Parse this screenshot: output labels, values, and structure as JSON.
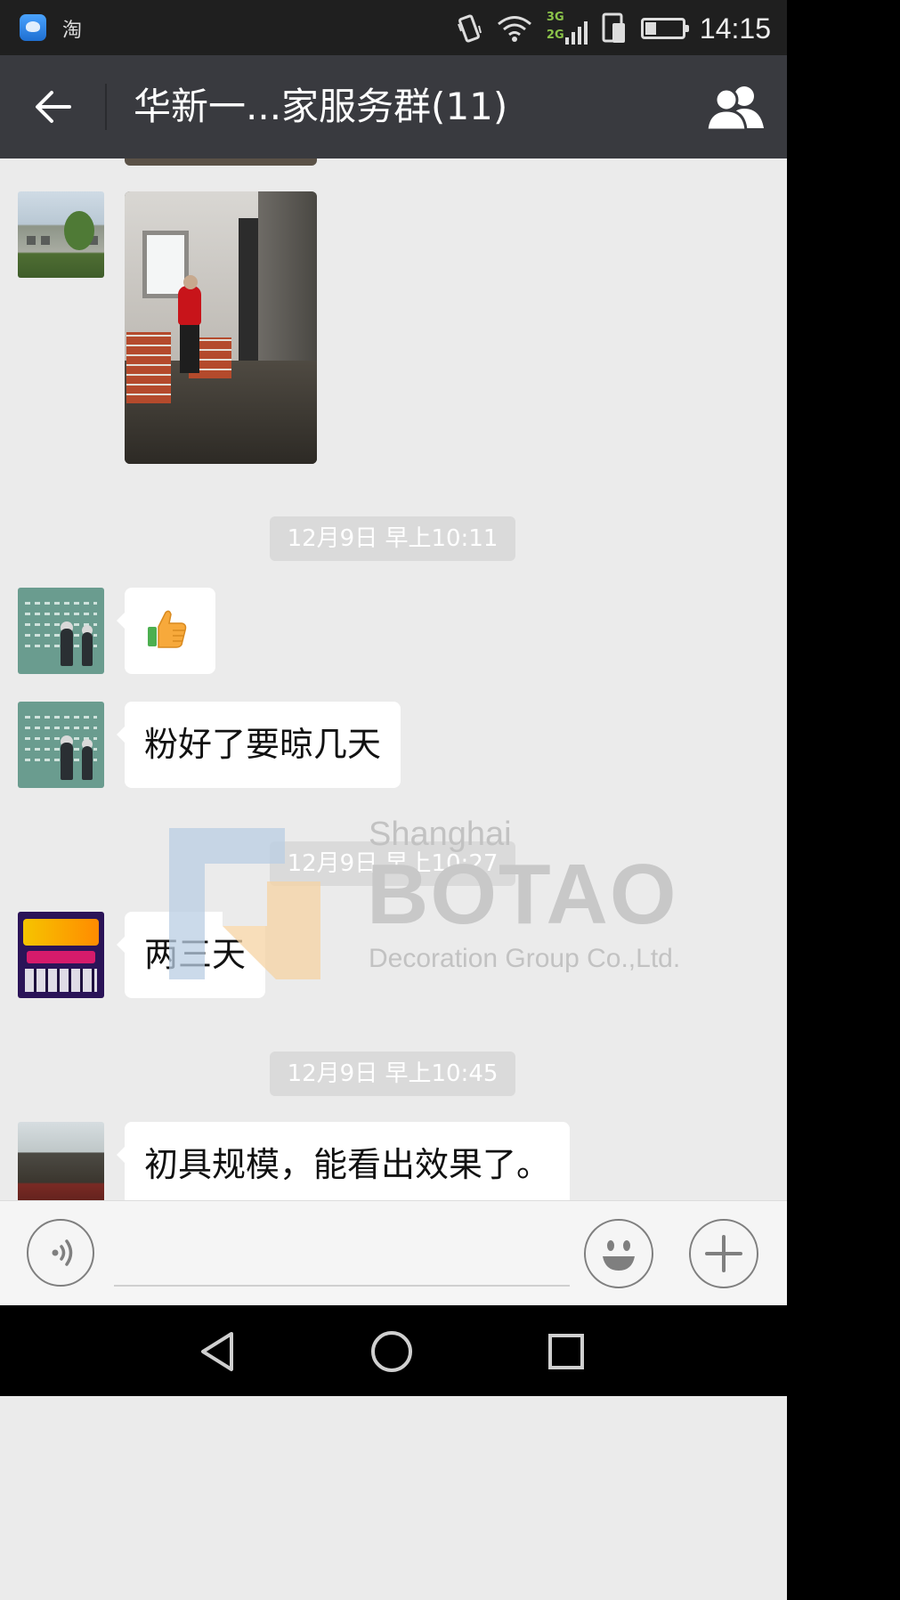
{
  "status_bar": {
    "app_label": "淘",
    "net_3g": "3G",
    "net_2g": "2G",
    "time": "14:15",
    "battery_level": 0.3
  },
  "header": {
    "title": "华新一...家服务群(11)"
  },
  "messages": [
    {
      "type": "image",
      "avatar": "building-avatar",
      "image": "construction-photo"
    },
    {
      "type": "time",
      "text": "12月9日 早上10:11"
    },
    {
      "type": "emoji",
      "avatar": "couple-avatar",
      "emoji": "thumbs-up"
    },
    {
      "type": "text",
      "avatar": "couple-avatar",
      "text": "粉好了要晾几天"
    },
    {
      "type": "time",
      "text": "12月9日 早上10:27"
    },
    {
      "type": "text",
      "avatar": "promo-avatar",
      "text": "两三天"
    },
    {
      "type": "time",
      "text": "12月9日 早上10:45"
    },
    {
      "type": "text",
      "avatar": "sculpture-avatar",
      "text": "初具规模，能看出效果了。"
    }
  ],
  "watermark": {
    "city": "Shanghai",
    "brand": "BOTAO",
    "subtitle": "Decoration Group Co.,Ltd."
  },
  "input_bar": {
    "placeholder": ""
  },
  "icons": {
    "back": "back-arrow-icon",
    "group": "group-members-icon",
    "voice": "voice-icon",
    "emoji": "smiley-icon",
    "plus": "plus-icon",
    "nav_back": "nav-back-icon",
    "nav_home": "nav-home-icon",
    "nav_recent": "nav-recent-icon"
  },
  "colors": {
    "title_bar": "#393a3f",
    "chat_bg": "#ebebeb",
    "bubble": "#ffffff"
  }
}
